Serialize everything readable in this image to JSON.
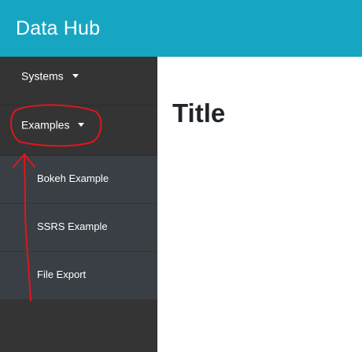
{
  "header": {
    "brand": "Data Hub",
    "background_color": "#17a6c2"
  },
  "sidebar": {
    "background_color": "#343434",
    "items": [
      {
        "label": "Systems",
        "has_dropdown": true
      },
      {
        "label": "Examples",
        "has_dropdown": true,
        "expanded": true
      }
    ],
    "submenu": {
      "background_color": "#3a3f45",
      "items": [
        {
          "label": "Bokeh Example"
        },
        {
          "label": "SSRS Example"
        },
        {
          "label": "File Export"
        }
      ]
    }
  },
  "main": {
    "title": "Title"
  },
  "annotation": {
    "color": "#e0161c",
    "shapes": [
      "circle",
      "arrow"
    ]
  }
}
